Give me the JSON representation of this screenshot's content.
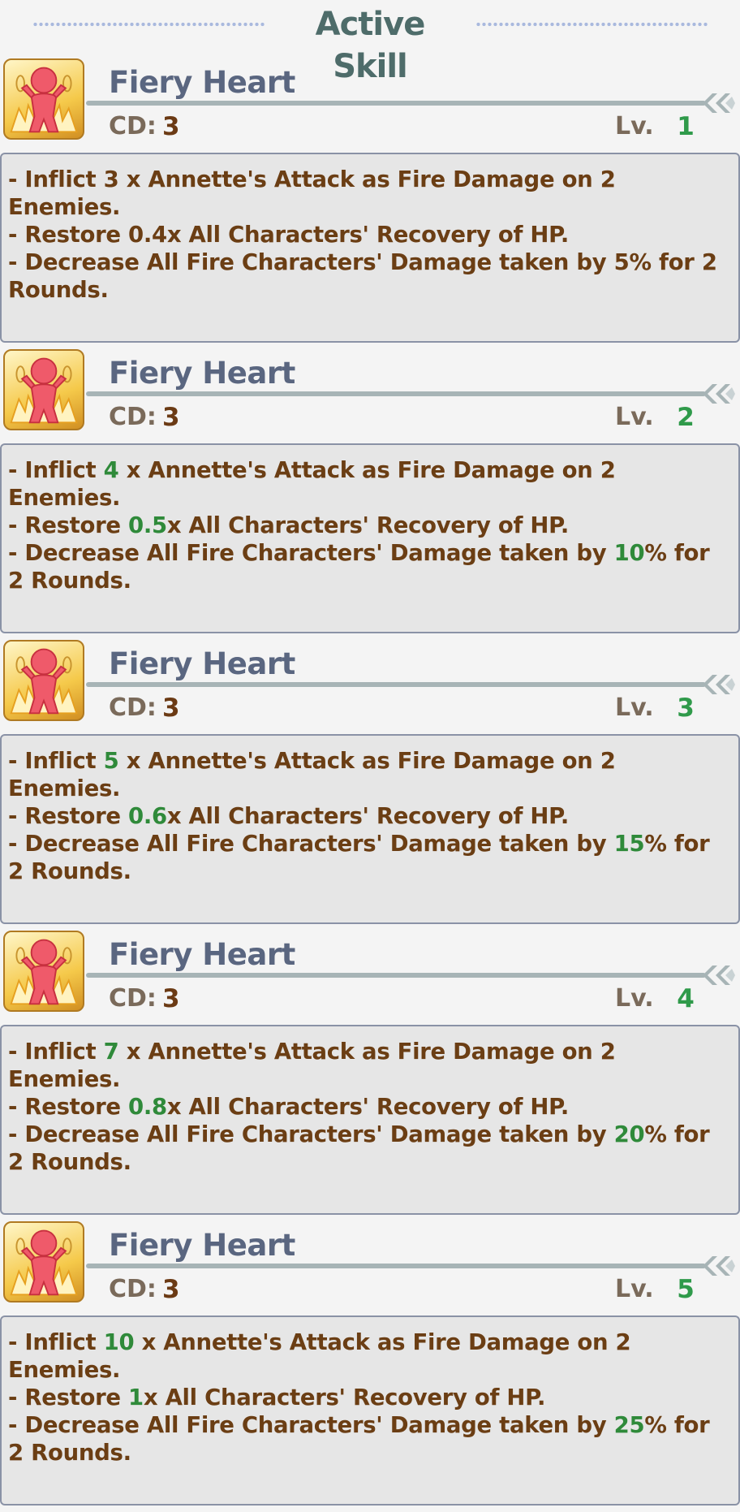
{
  "header": {
    "title": "Active Skill"
  },
  "skill_name": "Fiery Heart",
  "cd_label": "CD:",
  "lv_label": "Lv.",
  "icon": "fiery-heart-skill-icon",
  "colors": {
    "highlight": "#2f8a3a",
    "text": "#6b3e14",
    "title": "#5a6680",
    "header": "#4e6c6a"
  },
  "levels": [
    {
      "cd": "3",
      "lv": "1",
      "line1": [
        "- Inflict ",
        "3",
        " x Annette's Attack as Fire Damage on 2 Enemies."
      ],
      "line2": [
        "- Restore ",
        "0.4",
        "x All Characters' Recovery of HP."
      ],
      "line3": [
        "- Decrease All Fire Characters' Damage taken by ",
        "5",
        "% for 2 Rounds."
      ]
    },
    {
      "cd": "3",
      "lv": "2",
      "line1": [
        "- Inflict ",
        "4",
        " x Annette's Attack as Fire Damage on 2 Enemies."
      ],
      "line2": [
        "- Restore ",
        "0.5",
        "x All Characters' Recovery of HP."
      ],
      "line3": [
        "- Decrease All Fire Characters' Damage taken by ",
        "10",
        "% for 2 Rounds."
      ]
    },
    {
      "cd": "3",
      "lv": "3",
      "line1": [
        "- Inflict ",
        "5",
        " x Annette's Attack as Fire Damage on 2 Enemies."
      ],
      "line2": [
        "- Restore ",
        "0.6",
        "x All Characters' Recovery of HP."
      ],
      "line3": [
        "- Decrease All Fire Characters' Damage taken by ",
        "15",
        "% for 2 Rounds."
      ]
    },
    {
      "cd": "3",
      "lv": "4",
      "line1": [
        "- Inflict ",
        "7",
        " x Annette's Attack as Fire Damage on 2 Enemies."
      ],
      "line2": [
        "- Restore ",
        "0.8",
        "x All Characters' Recovery of HP."
      ],
      "line3": [
        "- Decrease All Fire Characters' Damage taken by ",
        "20",
        "% for 2 Rounds."
      ]
    },
    {
      "cd": "3",
      "lv": "5",
      "line1": [
        "- Inflict ",
        "10",
        " x Annette's Attack as Fire Damage on 2 Enemies."
      ],
      "line2": [
        "- Restore ",
        "1",
        "x All Characters' Recovery of HP."
      ],
      "line3": [
        "- Decrease All Fire Characters' Damage taken by ",
        "25",
        "% for 2 Rounds."
      ]
    }
  ]
}
